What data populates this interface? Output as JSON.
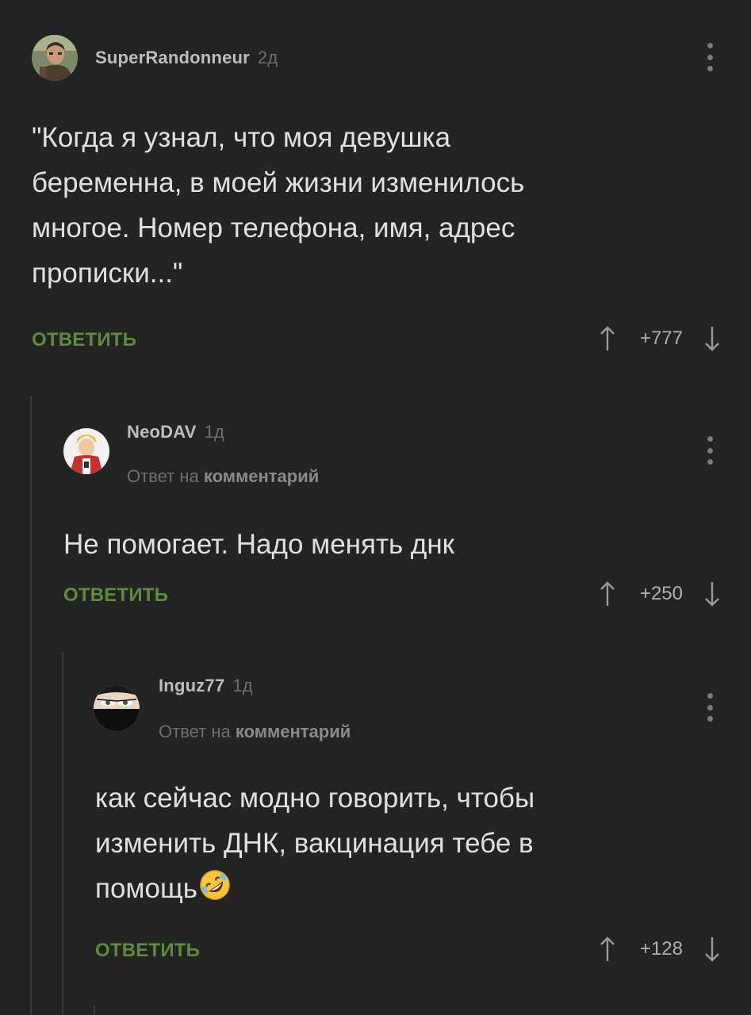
{
  "comments": [
    {
      "username": "SuperRandonneur",
      "age": "2д",
      "text": "\"Когда я узнал, что моя девушка\nбеременна, в моей жизни изменилось\nмногое. Номер телефона, имя, адрес\nпрописки...\"",
      "reply_label": "ОТВЕТИТЬ",
      "score": "+777"
    },
    {
      "username": "NeoDAV",
      "age": "1д",
      "reply_prefix": "Ответ на",
      "reply_link": "комментарий",
      "text": "Не помогает. Надо менять днк",
      "reply_label": "ОТВЕТИТЬ",
      "score": "+250"
    },
    {
      "username": "Inguz77",
      "age": "1д",
      "reply_prefix": "Ответ на",
      "reply_link": "комментарий",
      "text": "как сейчас модно говорить, чтобы\nизменить ДНК, вакцинация тебе в\nпомощь",
      "emoji": "rolling-on-floor-laughing-emoji",
      "reply_label": "ОТВЕТИТЬ",
      "score": "+128"
    }
  ],
  "icons": {
    "menu": "more-vertical-icon",
    "upvote": "arrow-up-icon",
    "downvote": "arrow-down-icon"
  },
  "colors": {
    "background": "#232323",
    "reply_button": "#5e8a3c",
    "thread_line": "#3a3a3a"
  }
}
